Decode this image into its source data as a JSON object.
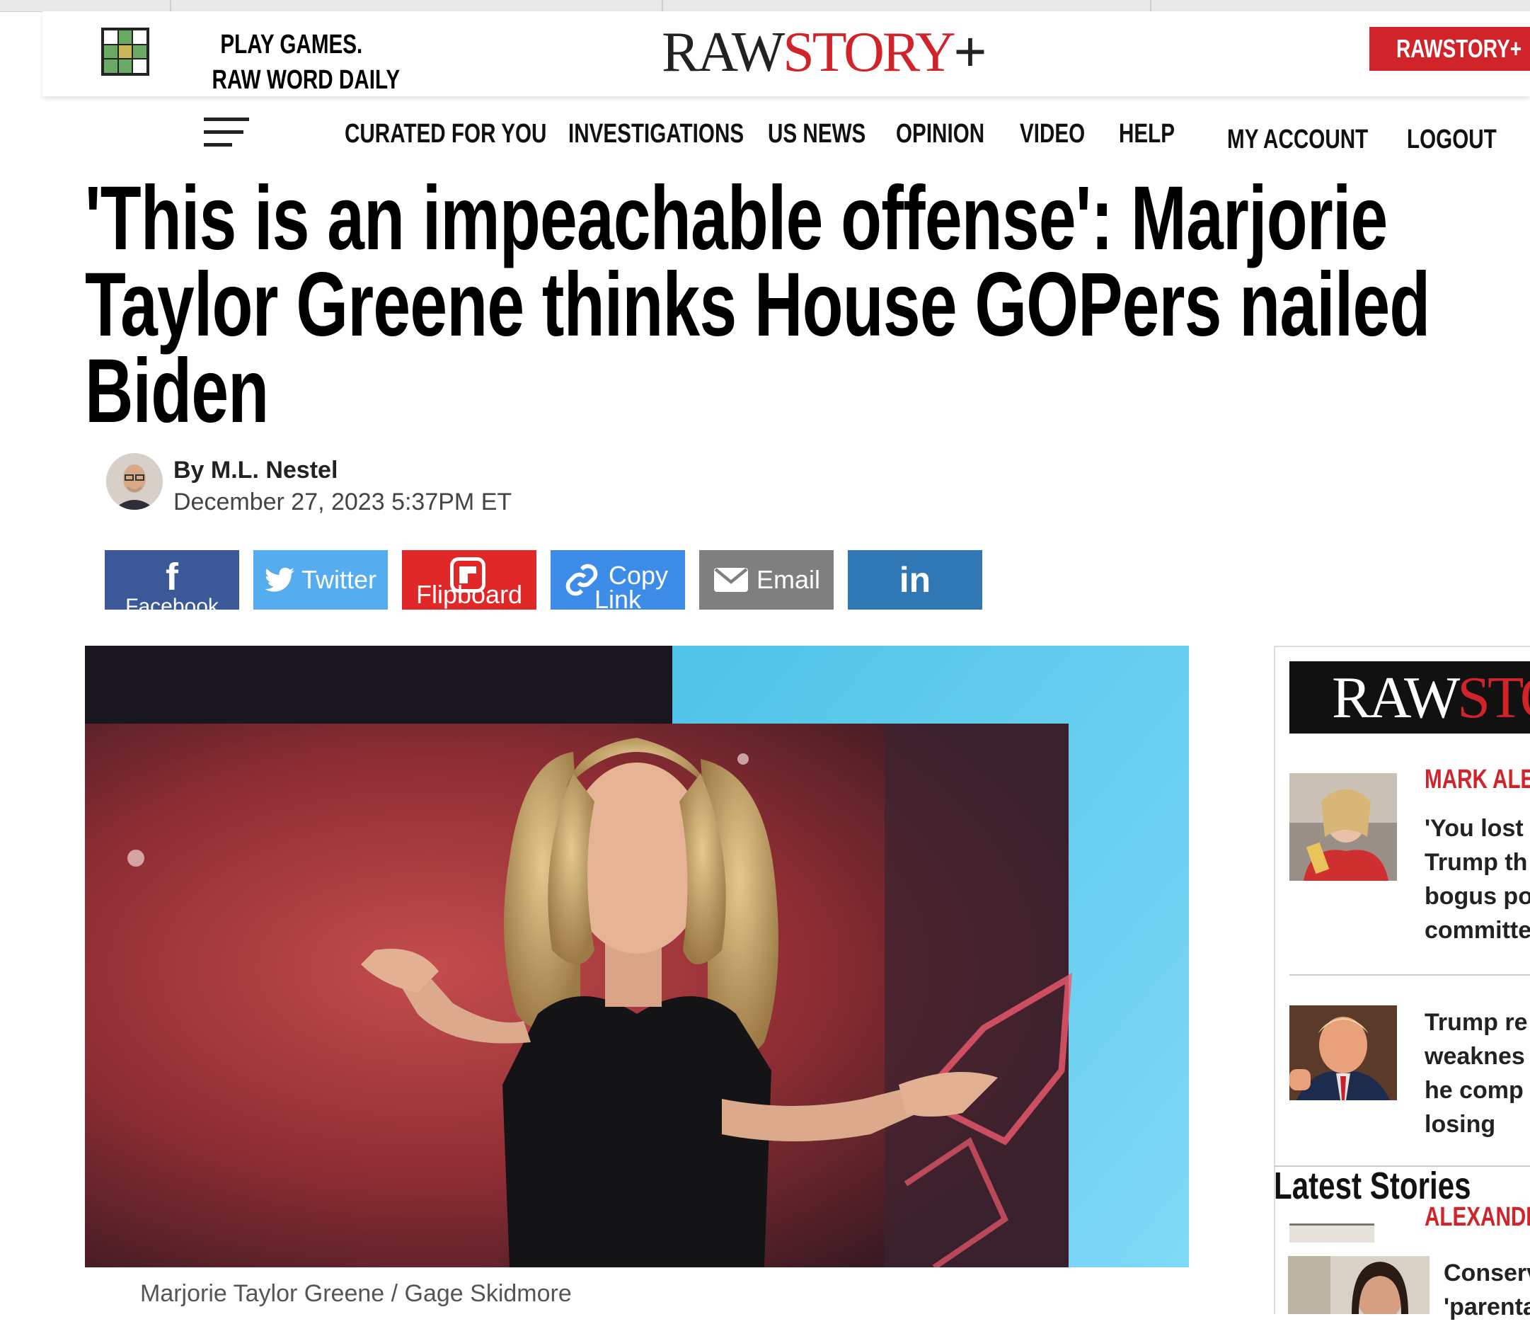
{
  "header": {
    "promo_line1": "PLAY GAMES.",
    "promo_line2": "RAW WORD DAILY",
    "logo_raw": "RAW",
    "logo_story": "STORY",
    "logo_plus": "+",
    "rawstory_plus_button": "RAWSTORY+"
  },
  "nav": {
    "items": [
      "CURATED FOR YOU",
      "INVESTIGATIONS",
      "US NEWS",
      "OPINION",
      "VIDEO",
      "HELP"
    ],
    "account": "MY ACCOUNT",
    "logout": "LOGOUT"
  },
  "article": {
    "headline": "'This is an impeachable offense': Marjorie Taylor Greene thinks House GOPers nailed Biden",
    "author": "By M.L. Nestel",
    "date": "December 27, 2023 5:37PM ET",
    "caption": "Marjorie Taylor Greene / Gage Skidmore"
  },
  "share": {
    "facebook_icon": "f",
    "facebook_label": "Facebook",
    "twitter_label": "Twitter",
    "flipboard_label": "Flipboard",
    "copy_label_line1": "Copy",
    "copy_label_line2": "Link",
    "email_label": "Email",
    "linkedin_icon": "in",
    "colors": {
      "facebook": "#3b5998",
      "twitter": "#55acee",
      "flipboard": "#e12828",
      "copy": "#3d8de8",
      "email": "#7f7f7f",
      "linkedin": "#2f77b5"
    }
  },
  "sidebar": {
    "logo_raw": "RAW",
    "logo_story": "STO",
    "story1_kicker": "MARK ALE",
    "story1_lines": [
      "'You lost",
      "Trump th",
      "bogus po",
      "committe"
    ],
    "story2_lines": [
      "Trump re",
      "weaknes",
      "he comp",
      "losing"
    ],
    "latest_heading": "Latest Stories",
    "story3_kicker": "ALEXANDR",
    "story4_lines": [
      "Conserv",
      "'parenta"
    ]
  },
  "colors": {
    "brand_red": "#d0232a"
  }
}
